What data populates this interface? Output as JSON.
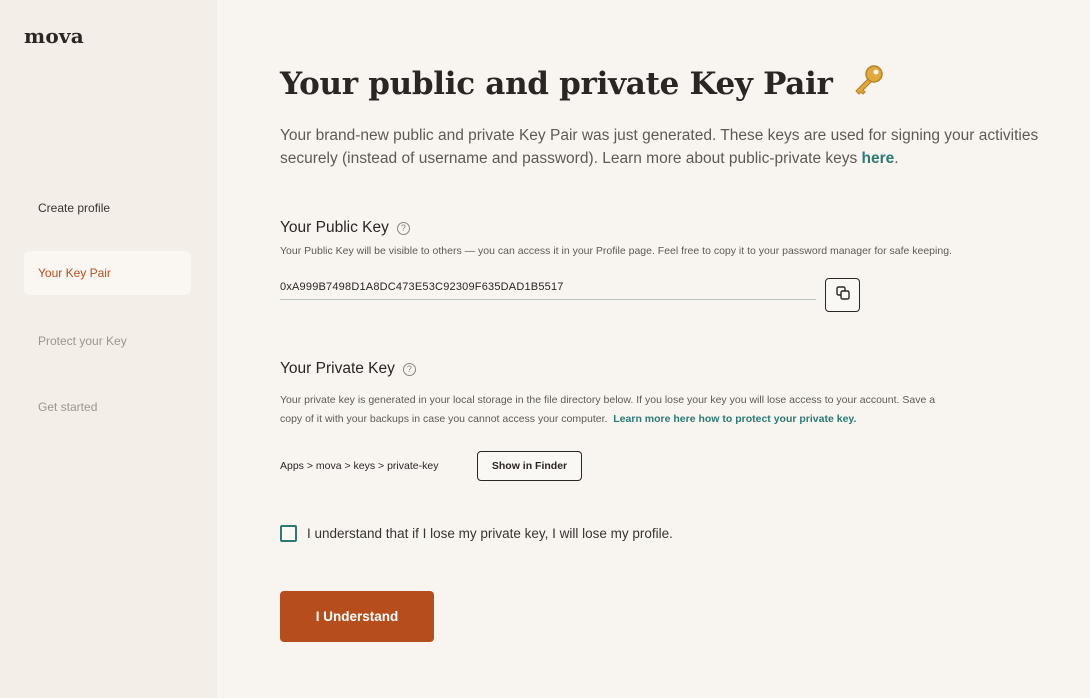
{
  "app": {
    "logo": "mova"
  },
  "sidebar": {
    "items": [
      {
        "label": "Create profile",
        "state": "done"
      },
      {
        "label": "Your Key Pair",
        "state": "active"
      },
      {
        "label": "Protect your Key",
        "state": "todo"
      },
      {
        "label": "Get started",
        "state": "todo"
      }
    ]
  },
  "page": {
    "title": "Your public and private Key Pair",
    "intro": "Your brand-new public and private Key Pair was just generated. These keys are used for signing your activities securely (instead of username and password). Learn more about public-private keys ",
    "intro_link": "here",
    "intro_end": "."
  },
  "public_key": {
    "title": "Your Public Key",
    "helper": "Your Public Key will be visible to others — you can access it in your Profile page. Feel free to copy it to your password manager for safe keeping.",
    "value": "0xA999B7498D1A8DC473E53C92309F635DAD1B5517"
  },
  "private_key": {
    "title": "Your Private Key",
    "helper_line1": "Your private key is generated in your local storage in the file directory below. If you lose your key you will lose access to your account. Save a",
    "helper_line2": "copy of it with your backups in case you cannot access your computer.",
    "helper_link": "Learn more here how to protect your private key.",
    "path": "Apps > mova > keys > private-key",
    "finder_button": "Show in Finder"
  },
  "confirm": {
    "checkbox_label": "I understand that if I lose my private key, I will lose my profile.",
    "checked": false,
    "button": "I Understand"
  },
  "colors": {
    "accent": "#b54e1c",
    "link": "#2b7a73",
    "sidebar_bg": "#f3eee8",
    "page_bg": "#f8f5f1"
  },
  "icons": {
    "title": "key-icon",
    "help": "help-circle-icon",
    "copy": "copy-icon"
  }
}
